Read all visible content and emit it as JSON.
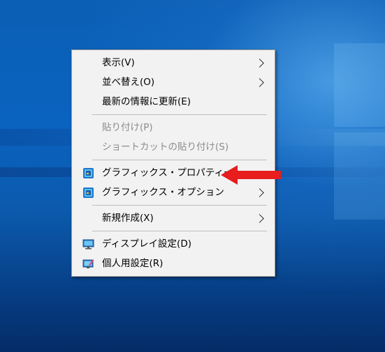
{
  "colors": {
    "desktop_blue": "#0b5fb4",
    "menu_bg": "#f2f2f2",
    "arrow_red": "#e81d1d",
    "disabled_text": "#8c8c8c"
  },
  "context_menu": {
    "items": [
      {
        "label": "表示(V)",
        "submenu": true,
        "enabled": true,
        "icon": ""
      },
      {
        "label": "並べ替え(O)",
        "submenu": true,
        "enabled": true,
        "icon": ""
      },
      {
        "label": "最新の情報に更新(E)",
        "submenu": false,
        "enabled": true,
        "icon": ""
      },
      {
        "label": "貼り付け(P)",
        "submenu": false,
        "enabled": false,
        "icon": ""
      },
      {
        "label": "ショートカットの貼り付け(S)",
        "submenu": false,
        "enabled": false,
        "icon": ""
      },
      {
        "label": "グラフィックス・プロパティー...",
        "submenu": false,
        "enabled": true,
        "icon": "intel-graphics-icon"
      },
      {
        "label": "グラフィックス・オプション",
        "submenu": true,
        "enabled": true,
        "icon": "intel-graphics-icon"
      },
      {
        "label": "新規作成(X)",
        "submenu": true,
        "enabled": true,
        "icon": ""
      },
      {
        "label": "ディスプレイ設定(D)",
        "submenu": false,
        "enabled": true,
        "icon": "display-settings-icon"
      },
      {
        "label": "個人用設定(R)",
        "submenu": false,
        "enabled": true,
        "icon": "personalize-icon"
      }
    ]
  },
  "annotation": {
    "icon": "red-arrow-icon",
    "points_to": "グラフィックス・プロパティー..."
  }
}
